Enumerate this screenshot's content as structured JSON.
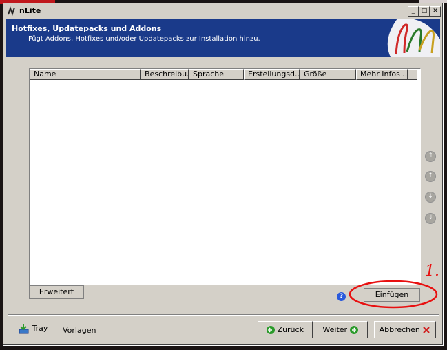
{
  "window": {
    "title": "nLite",
    "buttons": {
      "minimize": "_",
      "maximize": "□",
      "close": "✕"
    }
  },
  "header": {
    "title": "Hotfixes, Updatepacks und Addons",
    "subtitle": "Fügt Addons, Hotfixes und/oder Updatepacks zur Installation hinzu."
  },
  "list": {
    "columns": [
      "Name",
      "Beschreibu...",
      "Sprache",
      "Erstellungsd...",
      "Größe",
      "Mehr Infos ..."
    ],
    "rows": []
  },
  "buttons": {
    "erweitert": "Erweitert",
    "einfuegen": "Einfügen",
    "zurueck": "Zurück",
    "weiter": "Weiter",
    "abbrechen": "Abbrechen"
  },
  "footer": {
    "tray": "Tray",
    "vorlagen": "Vorlagen"
  },
  "annotation": {
    "number": "1."
  },
  "colors": {
    "header_bg": "#1a3a8a",
    "annotation_red": "#e81010"
  },
  "icons": [
    "nlite-logo-icon",
    "minimize-icon",
    "maximize-icon",
    "close-icon",
    "move-top-icon",
    "move-up-icon",
    "move-down-icon",
    "move-bottom-icon",
    "help-icon",
    "tray-icon",
    "back-arrow-icon",
    "forward-arrow-icon",
    "cancel-x-icon"
  ]
}
